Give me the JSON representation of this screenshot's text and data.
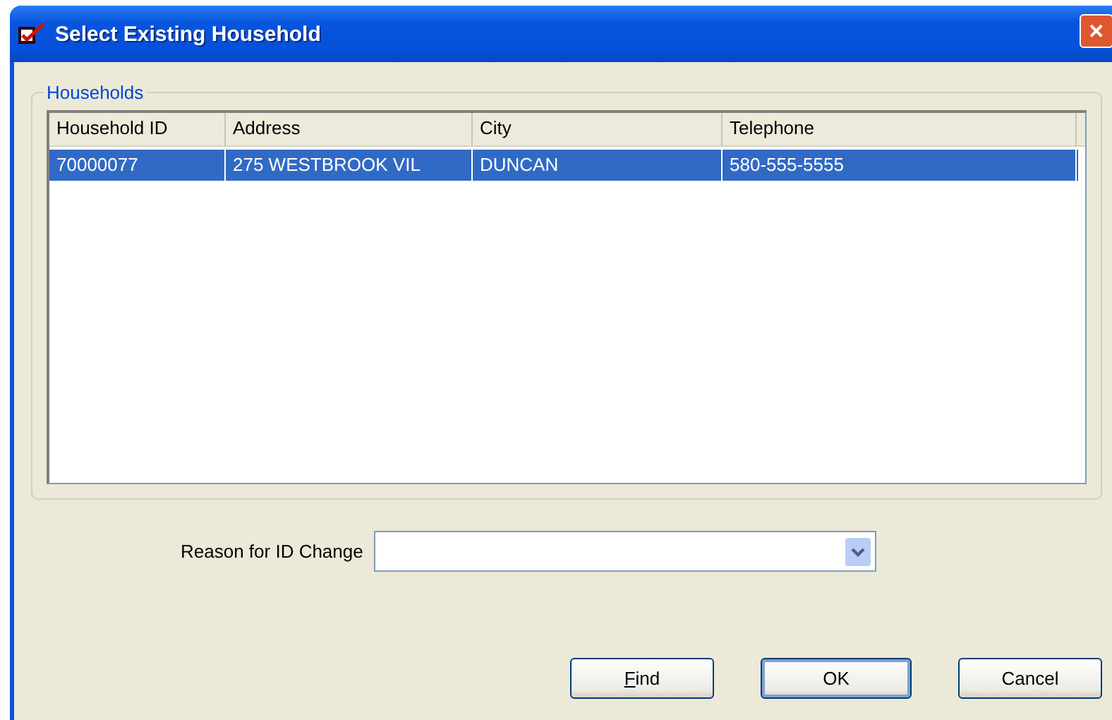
{
  "window": {
    "title": "Select Existing Household",
    "close": "✕"
  },
  "households": {
    "legend": "Households",
    "columns": [
      "Household ID",
      "Address",
      "City",
      "Telephone"
    ],
    "rows": [
      {
        "cells": [
          "70000077",
          "275 WESTBROOK VIL",
          "DUNCAN",
          "580-555-5555"
        ],
        "selected": true
      }
    ]
  },
  "reason": {
    "label": "Reason for ID Change"
  },
  "buttons": [
    {
      "label": "Find",
      "mnemonic": true,
      "default": false
    },
    {
      "label": "OK",
      "mnemonic": false,
      "default": true
    },
    {
      "label": "Cancel",
      "mnemonic": false,
      "default": false
    }
  ]
}
